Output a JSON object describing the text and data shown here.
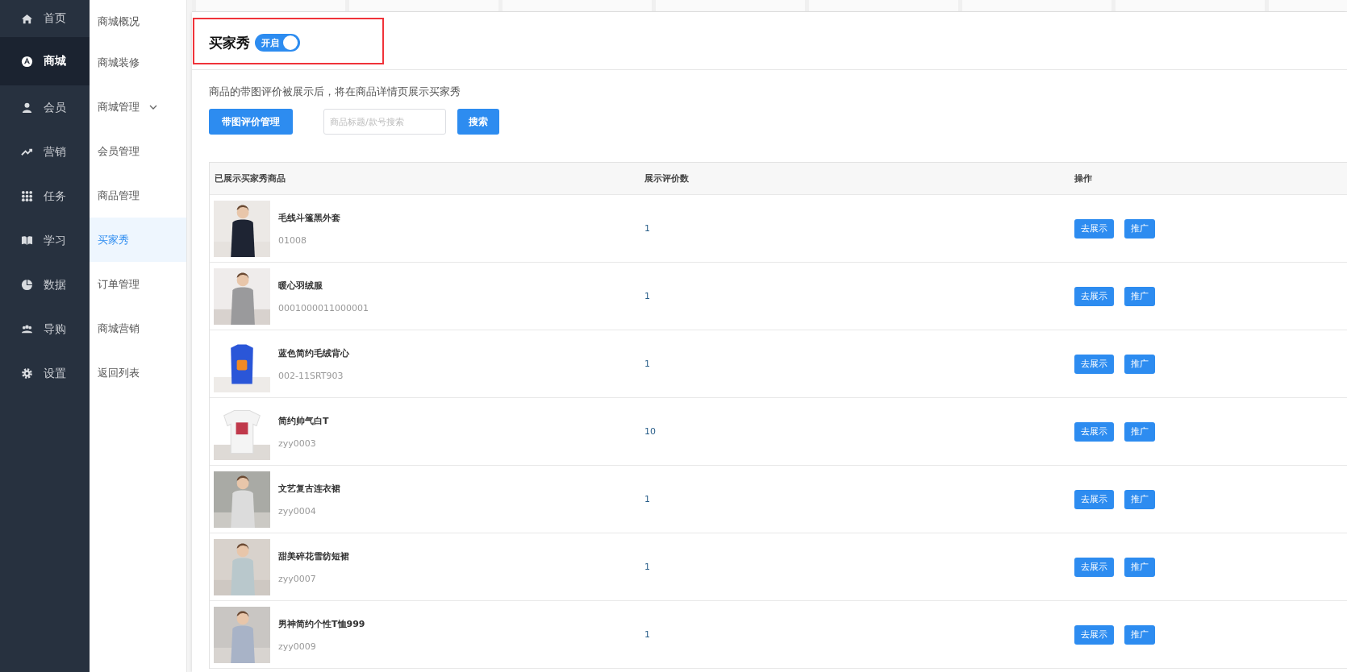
{
  "nav": [
    {
      "label": "首页",
      "kind": "home",
      "selected": false
    },
    {
      "label": "商城",
      "kind": "store",
      "selected": true
    },
    {
      "label": "会员",
      "kind": "user",
      "selected": false
    },
    {
      "label": "营销",
      "kind": "trend",
      "selected": false
    },
    {
      "label": "任务",
      "kind": "grid",
      "selected": false
    },
    {
      "label": "学习",
      "kind": "book",
      "selected": false
    },
    {
      "label": "数据",
      "kind": "pie",
      "selected": false
    },
    {
      "label": "导购",
      "kind": "team",
      "selected": false
    },
    {
      "label": "设置",
      "kind": "gear",
      "selected": false
    }
  ],
  "submenu": [
    {
      "label": "商城概况",
      "selected": false
    },
    {
      "label": "商城装修",
      "selected": false
    },
    {
      "label": "商城管理",
      "selected": false,
      "kind": "group"
    },
    {
      "label": "会员管理",
      "selected": false
    },
    {
      "label": "商品管理",
      "selected": false
    },
    {
      "label": "买家秀",
      "selected": true
    },
    {
      "label": "订单管理",
      "selected": false
    },
    {
      "label": "商城营销",
      "selected": false
    },
    {
      "label": "返回列表",
      "selected": false
    }
  ],
  "header": {
    "title": "买家秀",
    "toggle": {
      "label": "开启",
      "on": true
    }
  },
  "description": "商品的带图评价被展示后，将在商品详情页展示买家秀",
  "toolbar": {
    "manage_button": "带图评价管理",
    "search": {
      "placeholder": "商品标题/款号搜索"
    },
    "search_button": "搜索"
  },
  "table": {
    "columns": [
      "已展示买家秀商品",
      "展示评价数",
      "操作"
    ],
    "rows": [
      {
        "name": "毛线斗篷黑外套",
        "code": "01008",
        "count": "1",
        "actions": [
          "去展示",
          "推广"
        ]
      },
      {
        "name": "暖心羽绒服",
        "code": "0001000011000001",
        "count": "1",
        "actions": [
          "去展示",
          "推广"
        ]
      },
      {
        "name": "蓝色简约毛绒背心",
        "code": "002-11SRT903",
        "count": "1",
        "actions": [
          "去展示",
          "推广"
        ]
      },
      {
        "name": "简约帅气白T",
        "code": "zyy0003",
        "count": "10",
        "actions": [
          "去展示",
          "推广"
        ]
      },
      {
        "name": "文艺复古连衣裙",
        "code": "zyy0004",
        "count": "1",
        "actions": [
          "去展示",
          "推广"
        ]
      },
      {
        "name": "甜美碎花雪纺短裙",
        "code": "zyy0007",
        "count": "1",
        "actions": [
          "去展示",
          "推广"
        ]
      },
      {
        "name": "男神简约个性T恤999",
        "code": "zyy0009",
        "count": "1",
        "actions": [
          "去展示",
          "推广"
        ]
      }
    ]
  }
}
